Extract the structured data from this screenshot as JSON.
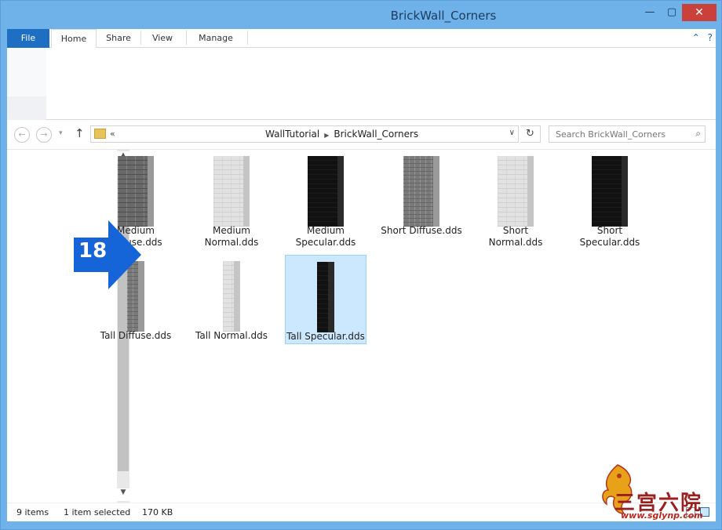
{
  "window": {
    "title": "BrickWall_Corners",
    "min_glyph": "—",
    "max_glyph": "▢",
    "close_glyph": "✕"
  },
  "ribbon": {
    "tabs": {
      "file": "File",
      "home": "Home",
      "share": "Share",
      "view": "View",
      "manage": "Manage"
    },
    "collapse_glyph": "⌃",
    "help_glyph": "?"
  },
  "navigation": {
    "back_glyph": "←",
    "forward_glyph": "→",
    "recent_glyph": "▾",
    "up_glyph": "↑",
    "address_prefix": "«",
    "breadcrumbs": [
      "WallTutorial",
      "BrickWall_Corners"
    ],
    "crumb_separator": "▶",
    "address_drop_glyph": "∨",
    "refresh_glyph": "↻",
    "search_placeholder": "Search BrickWall_Corners",
    "search_glyph": "⌕"
  },
  "scroll": {
    "up_glyph": "▲",
    "down_glyph": "▼"
  },
  "files": [
    {
      "name": "Medium\nDiffuse.dds",
      "line1": "Medium",
      "line2": "Diffuse.dds",
      "texture": "brick-dark",
      "icon": "medium-diffuse-thumbnail",
      "selected": false
    },
    {
      "name": "Medium\nNormal.dds",
      "line1": "Medium",
      "line2": "Normal.dds",
      "texture": "brick-light",
      "icon": "medium-normal-thumbnail",
      "selected": false
    },
    {
      "name": "Medium\nSpecular.dds",
      "line1": "Medium",
      "line2": "Specular.dds",
      "texture": "brick-black",
      "icon": "medium-specular-thumbnail",
      "selected": false
    },
    {
      "name": "Short Diffuse.dds",
      "line1": "Short Diffuse.dds",
      "line2": "",
      "texture": "brick-mid",
      "icon": "short-diffuse-thumbnail",
      "selected": false
    },
    {
      "name": "Short Normal.dds",
      "line1": "Short Normal.dds",
      "line2": "",
      "texture": "brick-light",
      "icon": "short-normal-thumbnail",
      "selected": false
    },
    {
      "name": "Short\nSpecular.dds",
      "line1": "Short",
      "line2": "Specular.dds",
      "texture": "brick-black",
      "icon": "short-specular-thumbnail",
      "selected": false
    },
    {
      "name": "Tall Diffuse.dds",
      "line1": "Tall Diffuse.dds",
      "line2": "",
      "texture": "brick-mid",
      "icon": "tall-diffuse-thumbnail",
      "selected": false
    },
    {
      "name": "Tall Normal.dds",
      "line1": "Tall Normal.dds",
      "line2": "",
      "texture": "brick-light",
      "icon": "tall-normal-thumbnail",
      "selected": false
    },
    {
      "name": "Tall Specular.dds",
      "line1": "Tall Specular.dds",
      "line2": "",
      "texture": "brick-black",
      "icon": "tall-specular-thumbnail",
      "selected": true
    }
  ],
  "annotation": {
    "step_number": "18",
    "color": "#1565d8"
  },
  "status": {
    "item_count": "9 items",
    "selection": "1 item selected",
    "size": "170 KB"
  },
  "watermark": {
    "text": "三宫六院",
    "url": "www.sglynp.com"
  },
  "colors": {
    "frame": "#6fb2ea",
    "file_tab": "#1e6fc3",
    "selection_fill": "#cce8ff",
    "selection_border": "#99d1ff",
    "close_button": "#c9413a"
  }
}
